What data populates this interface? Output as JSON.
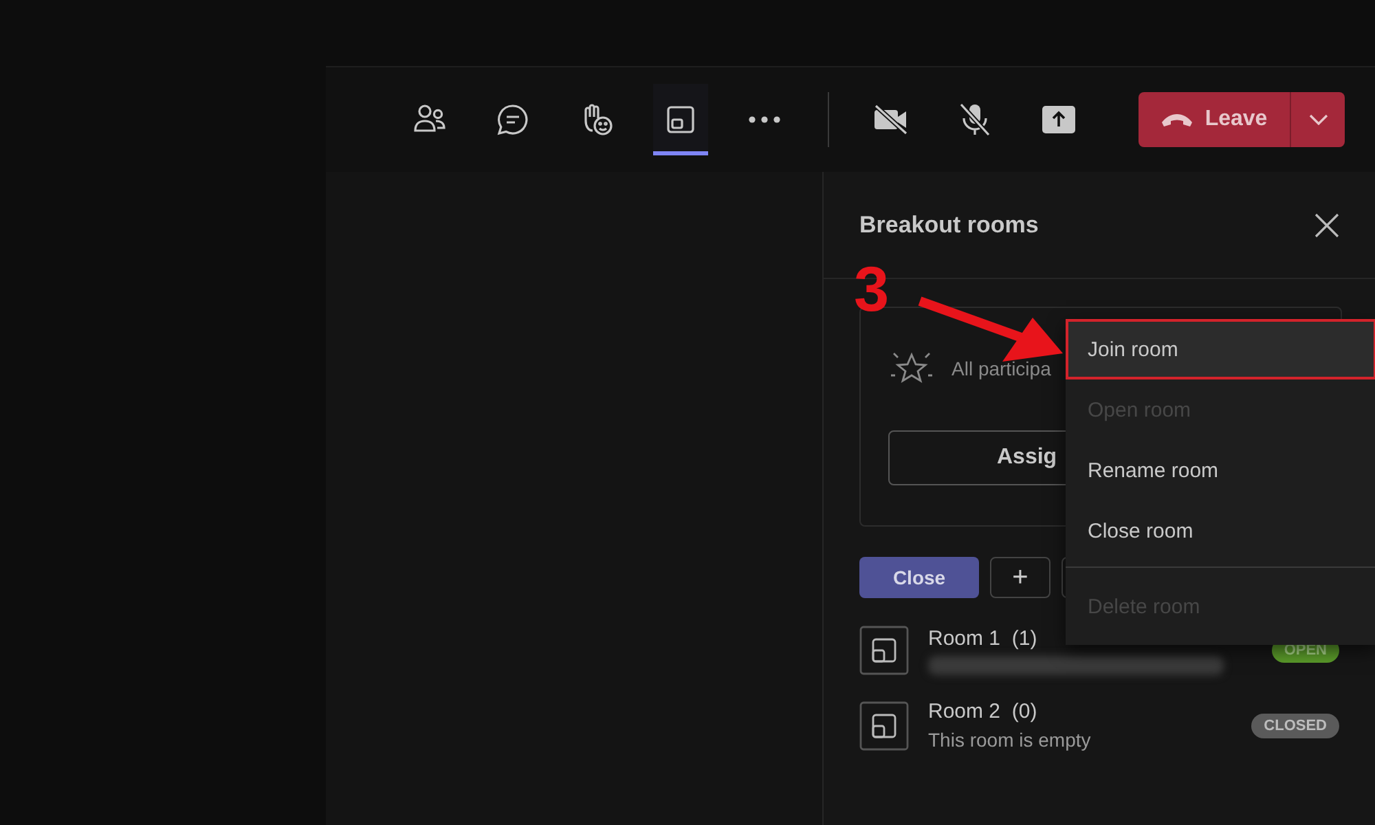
{
  "toolbar": {
    "items": [
      {
        "kind": "people",
        "selected": false
      },
      {
        "kind": "chat",
        "selected": false
      },
      {
        "kind": "react",
        "selected": false
      },
      {
        "kind": "rooms",
        "selected": true
      },
      {
        "kind": "more",
        "selected": false
      }
    ],
    "media": [
      {
        "kind": "camera"
      },
      {
        "kind": "mic"
      },
      {
        "kind": "share"
      }
    ],
    "leave": {
      "label": "Leave"
    }
  },
  "panel": {
    "title": "Breakout rooms",
    "card": {
      "text": "All participa",
      "button": "Assig"
    },
    "actions": {
      "close": "Close",
      "add": "+"
    },
    "rooms": [
      {
        "name": "Room 1",
        "count": "(1)",
        "subtitle_blurred": true,
        "status": "OPEN",
        "open": true
      },
      {
        "name": "Room 2",
        "count": "(0)",
        "subtitle": "This room is empty",
        "status": "CLOSED",
        "open": false
      }
    ]
  },
  "menu": {
    "items": [
      {
        "label": "Join room",
        "disabled": false,
        "selected": true,
        "annotated": true
      },
      {
        "label": "Open room",
        "disabled": true,
        "selected": false,
        "annotated": false
      },
      {
        "label": "Rename room",
        "disabled": false,
        "selected": false,
        "annotated": false
      },
      {
        "label": "Close room",
        "disabled": false,
        "selected": false,
        "annotated": false
      },
      {
        "label": "Delete room",
        "disabled": true,
        "selected": false,
        "annotated": false,
        "divider_before": true
      }
    ]
  },
  "annotation": {
    "step": "3"
  }
}
